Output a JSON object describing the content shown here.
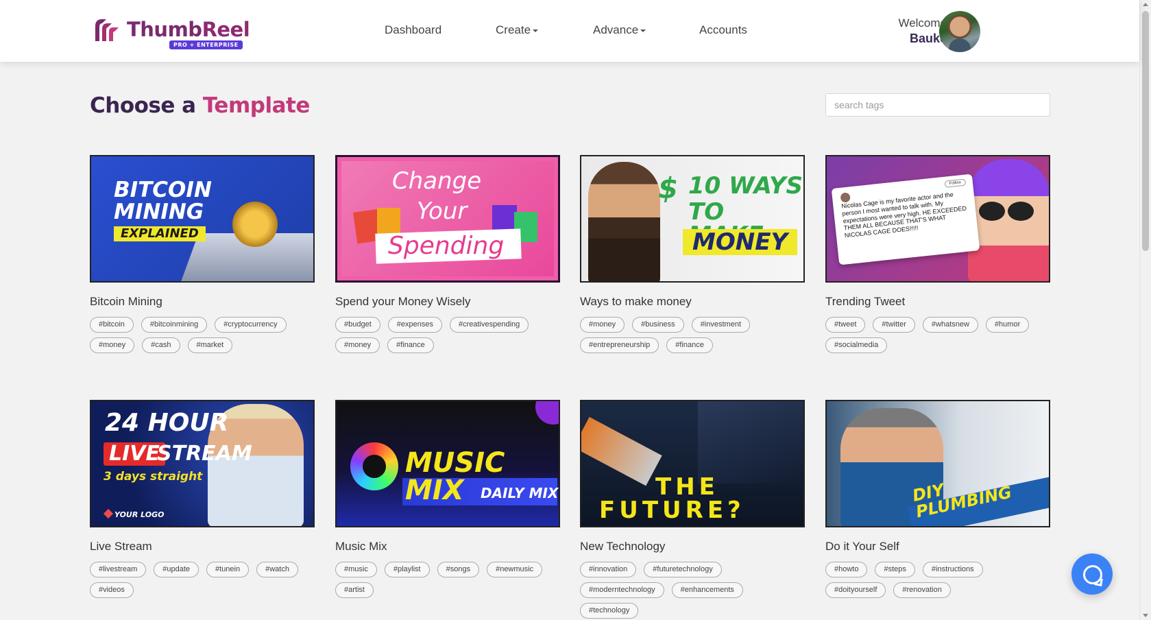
{
  "brand": {
    "name_part1": "Thumb",
    "name_part2": "Reel",
    "badge": "PRO + ENTERPRISE",
    "color_primary": "#7a2a6e",
    "color_accent": "#c23a7a"
  },
  "nav": {
    "dashboard": "Dashboard",
    "create": "Create",
    "advance": "Advance",
    "accounts": "Accounts"
  },
  "user": {
    "welcome": "Welcome",
    "name": "Bauke"
  },
  "page": {
    "title_part1": "Choose a",
    "title_part2": "Template",
    "search_placeholder": "search tags"
  },
  "templates": [
    {
      "title": "Bitcoin Mining",
      "thumb_lines": [
        "BITCOIN",
        "MINING",
        "EXPLAINED"
      ],
      "tags": [
        "#bitcoin",
        "#bitcoinmining",
        "#cryptocurrency",
        "#money",
        "#cash",
        "#market"
      ]
    },
    {
      "title": "Spend your Money Wisely",
      "thumb_lines": [
        "Change",
        "Your",
        "Spending"
      ],
      "tags": [
        "#budget",
        "#expenses",
        "#creativespending",
        "#money",
        "#finance"
      ]
    },
    {
      "title": "Ways to make money",
      "thumb_lines": [
        "$",
        "10 WAYS",
        "TO MAKE",
        "MONEY"
      ],
      "tags": [
        "#money",
        "#business",
        "#investment",
        "#entrepreneurship",
        "#finance"
      ]
    },
    {
      "title": "Trending Tweet",
      "thumb_lines": [
        "Nicolas Cage is my favorite actor and the person I most wanted to talk with. My expectations were very high. HE EXCEEDED THEM ALL BECAUSE THAT'S WHAT NICOLAS CAGE DOES!!!!!",
        "Follow"
      ],
      "tags": [
        "#tweet",
        "#twitter",
        "#whatsnew",
        "#humor",
        "#socialmedia"
      ]
    },
    {
      "title": "Live Stream",
      "thumb_lines": [
        "24 HOUR",
        "LIVE",
        "STREAM",
        "3 days straight",
        "YOUR LOGO"
      ],
      "tags": [
        "#livestream",
        "#update",
        "#tunein",
        "#watch",
        "#videos"
      ]
    },
    {
      "title": "Music Mix",
      "thumb_lines": [
        "MUSIC MIX",
        "DAILY MIX"
      ],
      "tags": [
        "#music",
        "#playlist",
        "#songs",
        "#newmusic",
        "#artist"
      ]
    },
    {
      "title": "New Technology",
      "thumb_lines": [
        "THE",
        "FUTURE?"
      ],
      "tags": [
        "#innovation",
        "#futuretechnology",
        "#moderntechnology",
        "#enhancements",
        "#technology"
      ]
    },
    {
      "title": "Do it Your Self",
      "thumb_lines": [
        "DIY PLUMBING"
      ],
      "tags": [
        "#howto",
        "#steps",
        "#instructions",
        "#doityourself",
        "#renovation"
      ]
    }
  ]
}
